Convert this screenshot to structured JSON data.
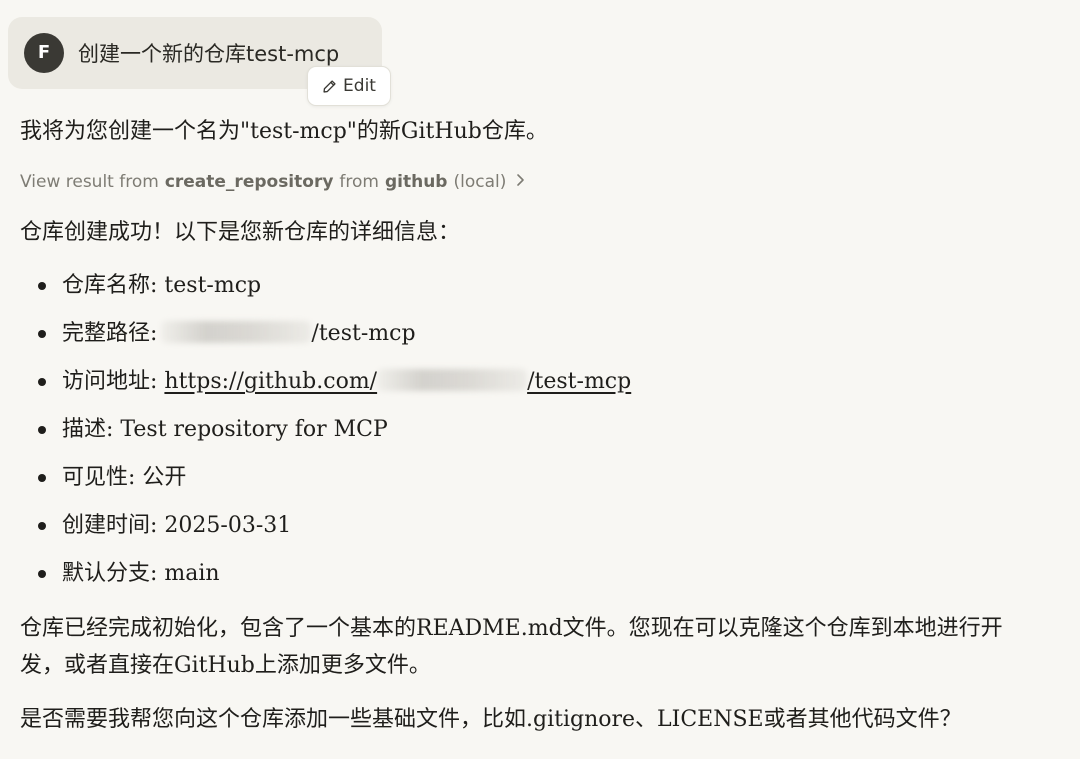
{
  "user_message": {
    "avatar_initial": "F",
    "text": "创建一个新的仓库test-mcp",
    "edit_label": "Edit",
    "edit_icon": "pencil-icon"
  },
  "assistant": {
    "intro": "我将为您创建一个名为\"test-mcp\"的新GitHub仓库。",
    "tool_result": {
      "prefix": "View result from",
      "tool_name": "create_repository",
      "from_word": "from",
      "server_name": "github",
      "server_suffix": "(local)",
      "chevron_icon": "chevron-right-icon"
    },
    "success_line": "仓库创建成功！以下是您新仓库的详细信息：",
    "details": [
      {
        "label": "仓库名称:",
        "value": "test-mcp"
      },
      {
        "label": "完整路径:",
        "value_prefix": "",
        "value_suffix": "/test-mcp"
      },
      {
        "label": "访问地址:",
        "link_prefix": "https://github.com/",
        "link_suffix": "/test-mcp"
      },
      {
        "label": "描述:",
        "value": "Test repository for MCP"
      },
      {
        "label": "可见性:",
        "value": "公开"
      },
      {
        "label": "创建时间:",
        "value": "2025-03-31"
      },
      {
        "label": "默认分支:",
        "value": "main"
      }
    ],
    "closing_line1": "仓库已经完成初始化，包含了一个基本的README.md文件。您现在可以克隆这个仓库到本地进行开",
    "closing_line2": "发，或者直接在GitHub上添加更多文件。",
    "question": "是否需要我帮您向这个仓库添加一些基础文件，比如.gitignore、LICENSE或者其他代码文件？"
  }
}
